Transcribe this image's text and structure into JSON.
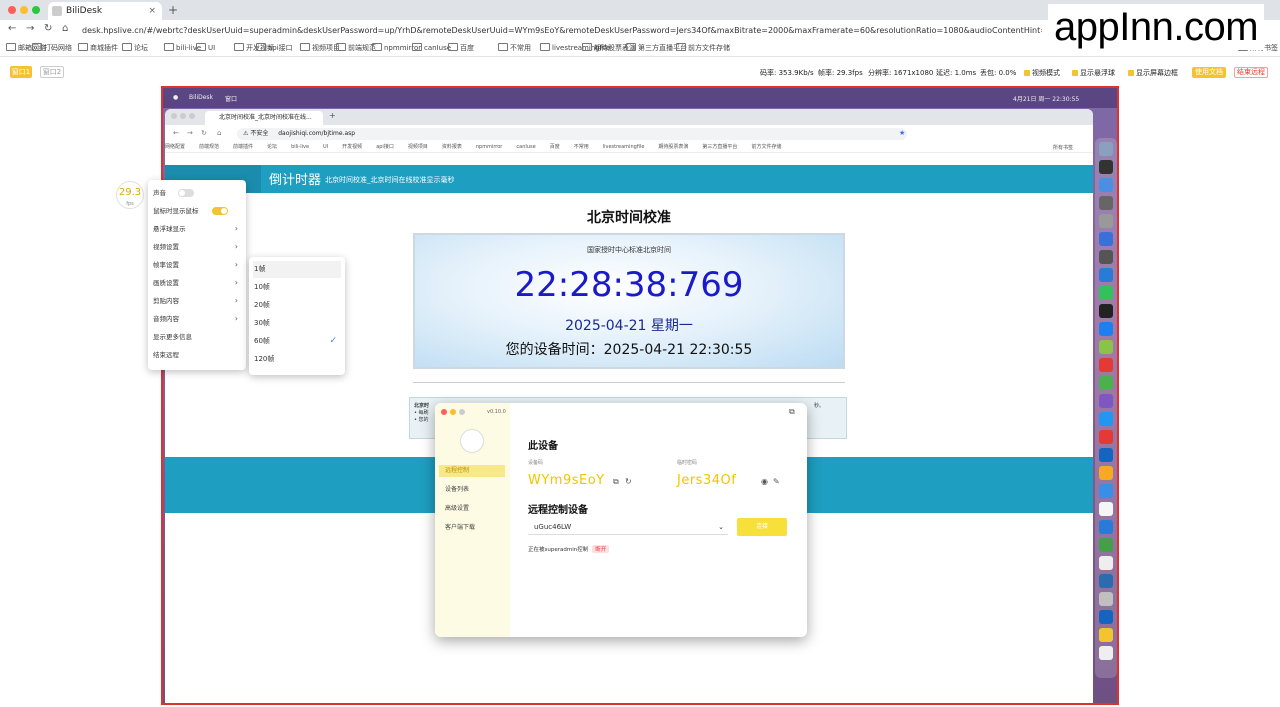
{
  "browser": {
    "tab_title": "BiliDesk",
    "url": "desk.hpslive.cn/#/webrtc?deskUserUuid=superadmin&deskUserPassword=up/YrhD&remoteDeskUserUuid=WYm9sEoY&remoteDeskUserPassword=Jers34Of&maxBitrate=2000&maxFramerate=60&resolutionRatio=1080&audioContentHint=&videoContentHint=detail",
    "bookmarks": [
      "邮箱网络",
      "打码网络",
      "商城插件",
      "论坛",
      "bili-live",
      "UI",
      "开发视频",
      "api接口",
      "视频项目",
      "前端规范",
      "npmmirror",
      "canIuse",
      "百度",
      "不常用",
      "livestreamingfile",
      "期待股票表演",
      "第三方直播平台",
      "前方文件存储"
    ],
    "bookmarks_right": "所有书签"
  },
  "watermark": "appInn.com",
  "toolbar": {
    "btn_a": "窗口1",
    "btn_b": "窗口2",
    "stats": [
      "码率: 353.9Kb/s",
      "帧率: 29.3fps",
      "分辨率: 1671x1080",
      "延迟: 1.0ms",
      "丢包: 0.0%"
    ],
    "checks": [
      "视频模式",
      "显示悬浮球",
      "显示屏幕边框"
    ],
    "doc_button": "使用文档",
    "end_button": "结束远程"
  },
  "remote": {
    "menubar_app": "BiliDesk",
    "menubar_menu": "窗口",
    "menubar_clock": "4月21日 周一 22:30:55",
    "tab_title": "北京时间校准_北京时间校准在线...",
    "insecure": "不安全",
    "address": "daojishiqi.com/bjtime.asp",
    "bookmarks": [
      "网络配置",
      "前端规范",
      "前端插件",
      "论坛",
      "bili-live",
      "UI",
      "开发视频",
      "api接口",
      "视频项目",
      "资料报表",
      "npmmirror",
      "canIuse",
      "百度",
      "不常用",
      "livestreamingfile",
      "期待股票表演",
      "第三方直播平台",
      "前方文件存储"
    ],
    "bookmarks_right": "所有书签",
    "site_title": "倒计时器",
    "site_subtitle": "北京时间校准_北京时间在线校准显示毫秒",
    "page_title": "北京时间校准",
    "clock_caption": "国家授时中心标准北京时间",
    "clock_time": "22:28:38:769",
    "clock_date": "2025-04-21 星期一",
    "device_time": "您的设备时间：2025-04-21 22:30:55",
    "info_title": "北京时",
    "info_line1": "• 每刷",
    "info_line2": "• 您的",
    "info_tail": "秒。"
  },
  "app": {
    "version": "v0.10.0",
    "side_items": [
      "远程控制",
      "设备列表",
      "高级设置",
      "客户端下载"
    ],
    "this_device": "此设备",
    "device_id_label": "设备码",
    "temp_pw_label": "临时密码",
    "device_id": "WYm9sEoY",
    "temp_pw": "Jers34Of",
    "remote_title": "远程控制设备",
    "remote_select": "uGuc46LW",
    "connect_button": "连接",
    "status": "正在被superadmin控制",
    "status_tag": "断开"
  },
  "fps": {
    "value": "29.3",
    "unit": "fps"
  },
  "menu": {
    "items": [
      "声音",
      "鼠标时显示鼠标",
      "悬浮球显示",
      "视频设置",
      "帧率设置",
      "画质设置",
      "剪贴内容",
      "音频内容",
      "显示更多信息",
      "结束远程"
    ]
  },
  "submenu": {
    "items": [
      "1帧",
      "10帧",
      "20帧",
      "30帧",
      "60帧",
      "120帧"
    ],
    "checked": "60帧"
  },
  "colors": {
    "accent": "#f4c430",
    "teal": "#1e9ec0",
    "border": "#e03030"
  }
}
